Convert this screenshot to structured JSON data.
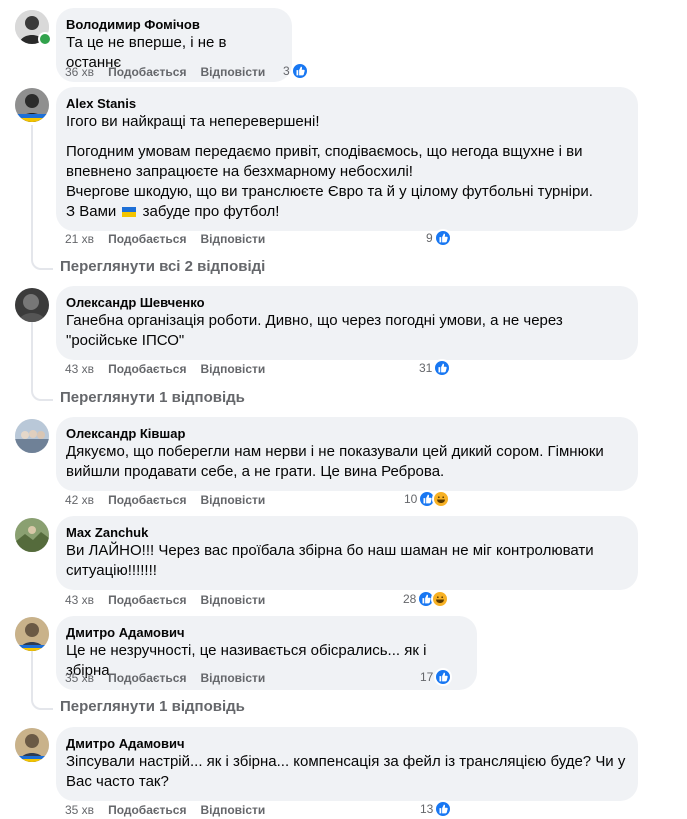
{
  "comments": [
    {
      "author": "Володимир Фомічов",
      "lines": [
        "Та це не вперше, і не в останнє"
      ],
      "time": "36 хв",
      "like": "Подобається",
      "reply": "Відповісти",
      "reactions": "3",
      "reaction_types": [
        "like-icon"
      ]
    },
    {
      "author": "Alex Stanis",
      "paragraphs": [
        "Ігого ви найкращі та неперевершені!",
        "Погодним умовам передаємо привіт, сподіваємось, що негода вщухне і ви впевнено запрацюєте на безхмарному небосхилі!",
        "Вчергове шкодую, що ви транслюєте Євро та й у цілому футбольні турніри.",
        "З Вами",
        "забуде про футбол!"
      ],
      "time": "21 хв",
      "like": "Подобається",
      "reply": "Відповісти",
      "reactions": "9",
      "reaction_types": [
        "like-icon"
      ],
      "view_replies": "Переглянути всі 2 відповіді"
    },
    {
      "author": "Олександр Шевченко",
      "lines": [
        "Ганебна організація роботи. Дивно, що через погодні умови, а не через",
        "\"російське ІПСО\""
      ],
      "time": "43 хв",
      "like": "Подобається",
      "reply": "Відповісти",
      "reactions": "31",
      "reaction_types": [
        "like-icon"
      ],
      "view_replies": "Переглянути 1 відповідь"
    },
    {
      "author": "Олександр Ківшар",
      "lines": [
        "Дякуємо, що поберегли нам нерви і не показували цей дикий сором. Гімнюки",
        "вийшли продавати себе, а не грати. Це вина Реброва."
      ],
      "time": "42 хв",
      "like": "Подобається",
      "reply": "Відповісти",
      "reactions": "10",
      "reaction_types": [
        "like-icon",
        "haha-icon"
      ]
    },
    {
      "author": "Max Zanchuk",
      "lines": [
        "Ви ЛАЙНО!!! Через вас проїбала збірна бо наш шаман не міг контролювати",
        "ситуацію!!!!!!!"
      ],
      "time": "43 хв",
      "like": "Подобається",
      "reply": "Відповісти",
      "reactions": "28",
      "reaction_types": [
        "like-icon",
        "haha-icon"
      ]
    },
    {
      "author": "Дмитро Адамович",
      "lines": [
        "Це не незручності, це називається обісрались... як і збірна"
      ],
      "time": "35 хв",
      "like": "Подобається",
      "reply": "Відповісти",
      "reactions": "17",
      "reaction_types": [
        "like-icon"
      ],
      "view_replies": "Переглянути 1 відповідь"
    },
    {
      "author": "Дмитро Адамович",
      "lines": [
        "Зіпсували настрій... як і збірна... компенсація за фейл із трансляцією буде? Чи у",
        "Вас часто так?"
      ],
      "time": "35 хв",
      "like": "Подобається",
      "reply": "Відповісти",
      "reactions": "13",
      "reaction_types": [
        "like-icon"
      ]
    }
  ],
  "colors": {
    "bubble": "#f0f2f5",
    "meta": "#65676b",
    "like": "#1877f2",
    "haha": "#f7b125",
    "online": "#31a24c"
  }
}
